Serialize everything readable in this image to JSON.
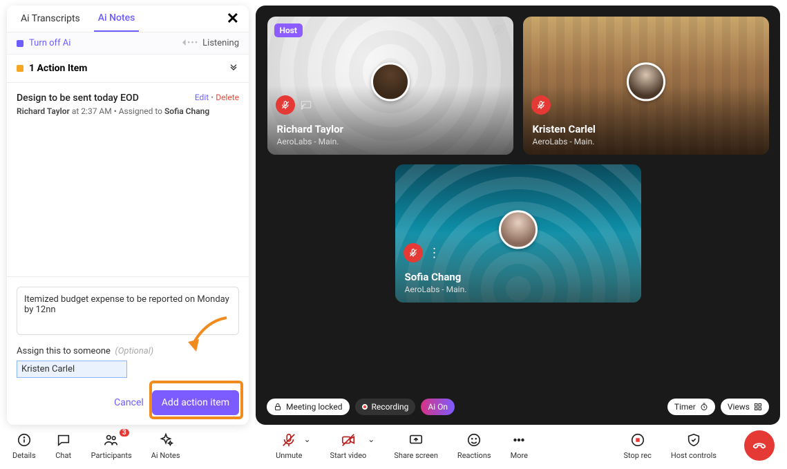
{
  "sidebar": {
    "tabs": {
      "transcripts": "Ai Transcripts",
      "notes": "Ai Notes"
    },
    "ai_strip": {
      "turn_off": "Turn off Ai",
      "listening": "Listening"
    },
    "action_header": "1 Action Item",
    "item": {
      "title": "Design to be sent today EOD",
      "author": "Richard Taylor",
      "at": " at 2:37 AM • Assigned to ",
      "assignee": "Sofia Chang",
      "edit": "Edit",
      "delete": "Delete"
    },
    "compose": {
      "text": "Itemized budget expense to be reported on Monday by 12nn",
      "assign_label": "Assign this to someone",
      "assign_optional": "(Optional)",
      "assign_value": "Kristen Carlel",
      "cancel": "Cancel",
      "add": "Add action item"
    }
  },
  "stage": {
    "tiles": [
      {
        "name": "Richard Taylor",
        "sub": "AeroLabs - Main.",
        "host": "Host"
      },
      {
        "name": "Kristen Carlel",
        "sub": "AeroLabs - Main."
      },
      {
        "name": "Sofia Chang",
        "sub": "AeroLabs - Main."
      }
    ],
    "pills": {
      "locked": "Meeting locked",
      "recording": "Recording",
      "ai": "Ai On",
      "timer": "Timer",
      "views": "Views"
    }
  },
  "toolbar": {
    "details": "Details",
    "chat": "Chat",
    "participants": "Participants",
    "participants_badge": "3",
    "ainotes": "Ai Notes",
    "unmute": "Unmute",
    "startvideo": "Start video",
    "sharescreen": "Share screen",
    "reactions": "Reactions",
    "more": "More",
    "stoprec": "Stop rec",
    "hostcontrols": "Host controls"
  }
}
